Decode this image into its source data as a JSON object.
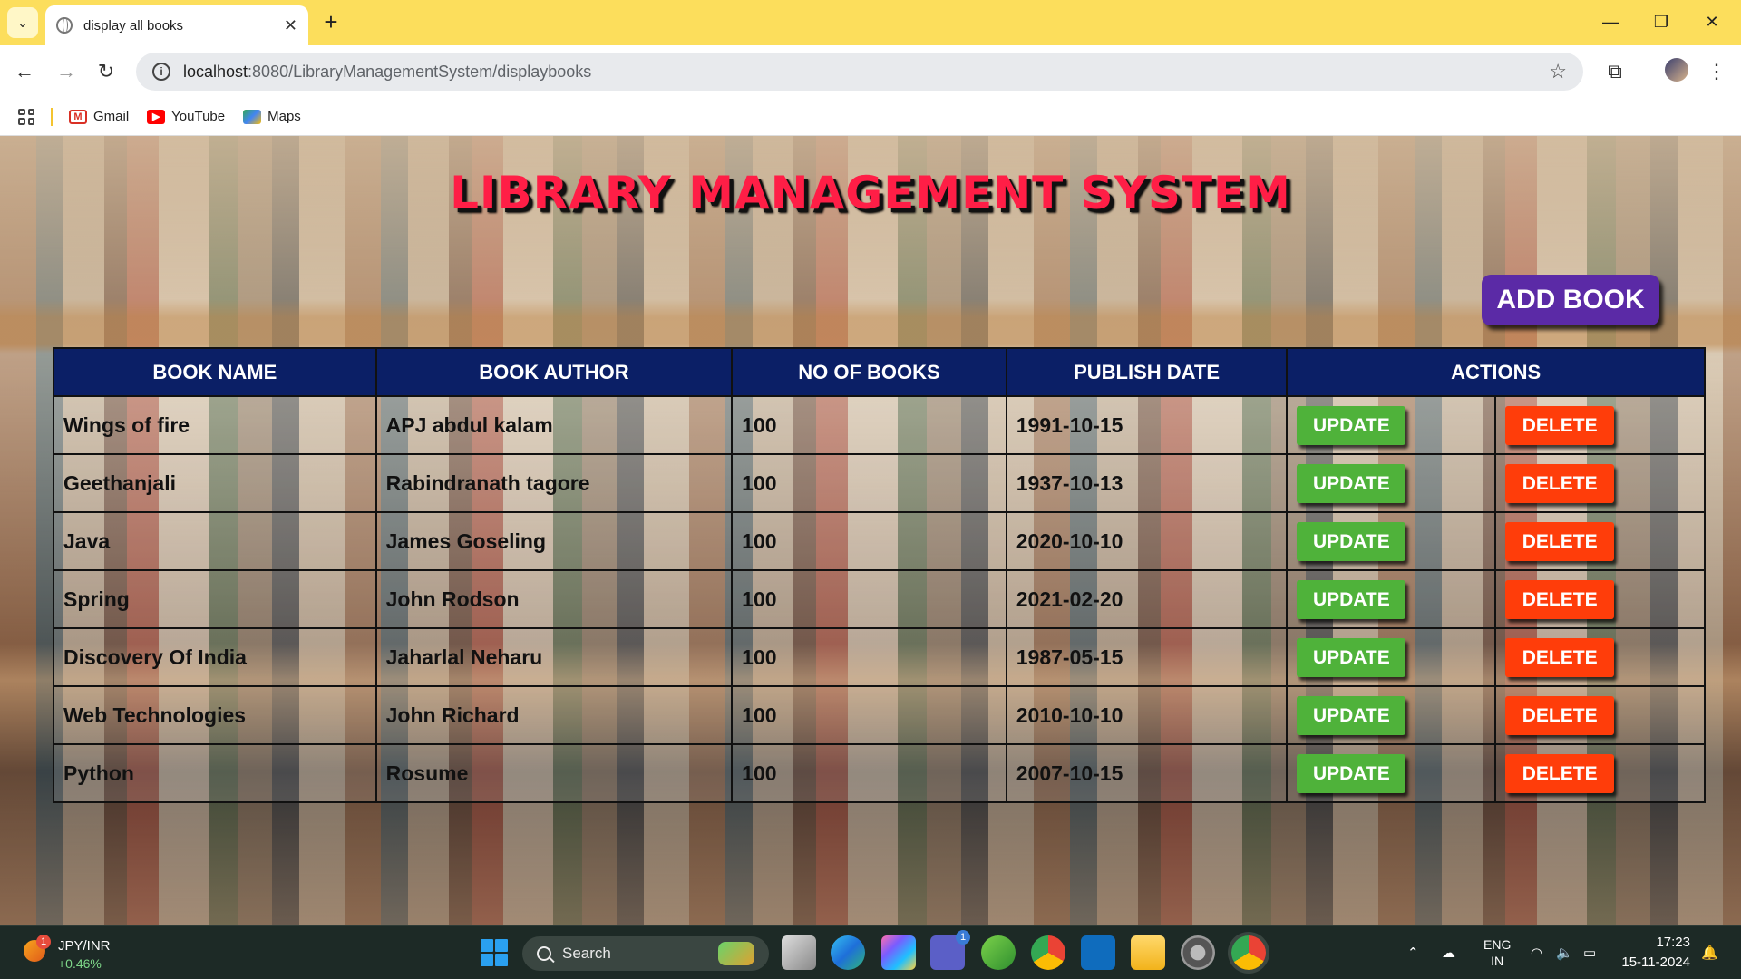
{
  "browser": {
    "tab_title": "display all books",
    "url_host": "localhost",
    "url_path": ":8080/LibraryManagementSystem/displaybooks",
    "bookmarks": [
      "Gmail",
      "YouTube",
      "Maps"
    ]
  },
  "page": {
    "title": "LIBRARY MANAGEMENT SYSTEM",
    "add_button": "ADD BOOK",
    "columns": [
      "BOOK NAME",
      "BOOK AUTHOR",
      "NO OF BOOKS",
      "PUBLISH DATE",
      "ACTIONS"
    ],
    "update_label": "UPDATE",
    "delete_label": "DELETE",
    "rows": [
      {
        "name": "Wings of fire",
        "author": "APJ abdul kalam",
        "count": "100",
        "date": "1991-10-15"
      },
      {
        "name": "Geethanjali",
        "author": "Rabindranath tagore",
        "count": "100",
        "date": "1937-10-13"
      },
      {
        "name": "Java",
        "author": "James Goseling",
        "count": "100",
        "date": "2020-10-10"
      },
      {
        "name": "Spring",
        "author": "John Rodson",
        "count": "100",
        "date": "2021-02-20"
      },
      {
        "name": "Discovery Of India",
        "author": "Jaharlal Neharu",
        "count": "100",
        "date": "1987-05-15"
      },
      {
        "name": "Web Technologies",
        "author": "John Richard",
        "count": "100",
        "date": "2010-10-10"
      },
      {
        "name": "Python",
        "author": "Rosume",
        "count": "100",
        "date": "2007-10-15"
      }
    ],
    "colors": {
      "title": "#ff1e46",
      "header_bg": "#0b1f66",
      "add_button": "#5b2aa6",
      "update": "#4fb23a",
      "delete": "#ff3d0a"
    }
  },
  "taskbar": {
    "widget_name": "JPY/INR",
    "widget_value": "+0.46%",
    "widget_badge": "1",
    "search_label": "Search",
    "teams_badge": "1",
    "lang_line1": "ENG",
    "lang_line2": "IN",
    "time": "17:23",
    "date": "15-11-2024"
  }
}
